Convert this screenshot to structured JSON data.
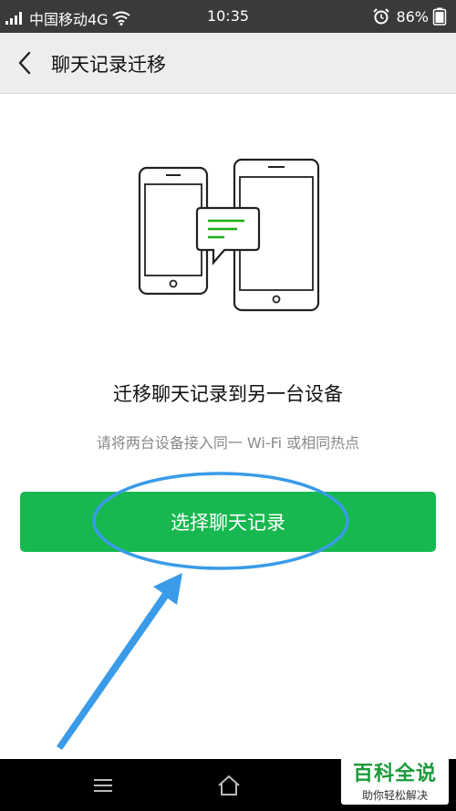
{
  "status_bar": {
    "carrier": "中国移动4G",
    "time": "10:35",
    "battery": "86%",
    "icons": [
      "signal-icon",
      "wifi-icon",
      "alarm-icon",
      "battery-icon"
    ]
  },
  "header": {
    "title": "聊天记录迁移",
    "back_icon": "back-arrow-icon"
  },
  "main": {
    "illustration": "two-phones-message-icon",
    "heading": "迁移聊天记录到另一台设备",
    "subtext": "请将两台设备接入同一 Wi-Fi 或相同热点",
    "button_label": "选择聊天记录"
  },
  "nav_bar": {
    "icons": [
      "menu-icon",
      "home-icon"
    ]
  },
  "watermark": {
    "main": "百科全说",
    "sub": "助你轻松解决"
  },
  "colors": {
    "accent": "#17b84f",
    "status_bar": "#3a3a3a",
    "title_bar": "#ededed",
    "annotation": "#3a9be8"
  }
}
